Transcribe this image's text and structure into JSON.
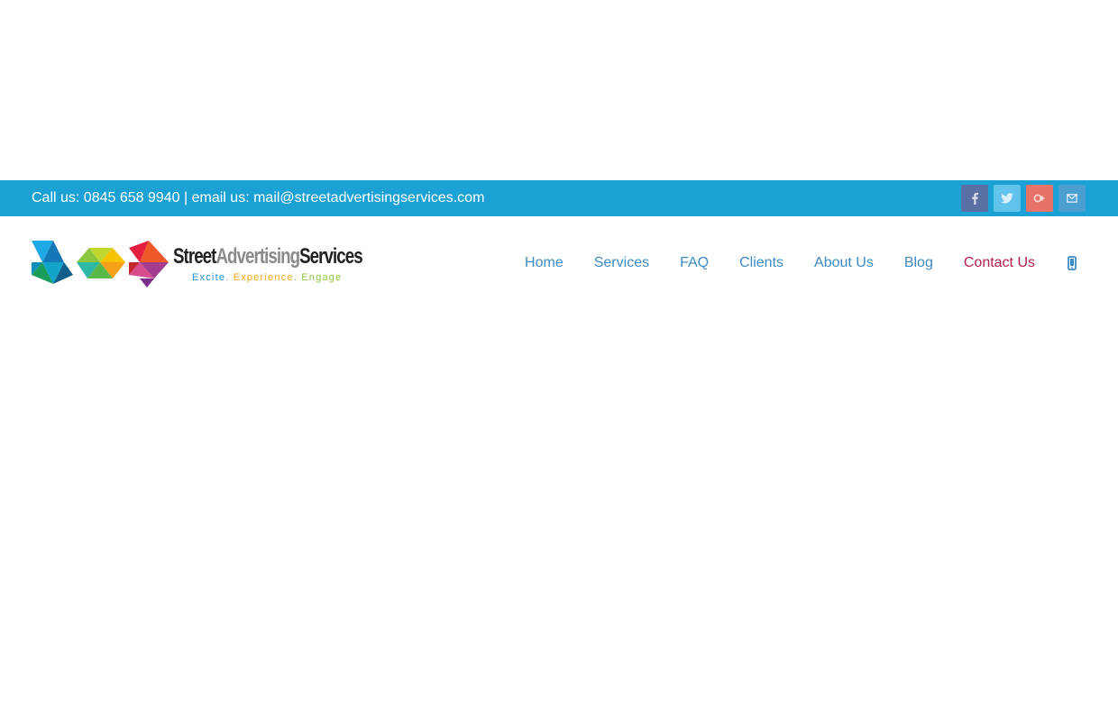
{
  "topbar": {
    "contact_text": "Call us: 0845 658 9940 | email us: mail@streetadvertisingservices.com",
    "background": "#1ba1d3",
    "social": [
      {
        "name": "facebook-icon",
        "color": "#3b5998"
      },
      {
        "name": "twitter-icon",
        "color": "#55acee"
      },
      {
        "name": "googleplus-icon",
        "color": "#dc4e41"
      },
      {
        "name": "email-icon",
        "color": "#3a8dc7"
      }
    ]
  },
  "logo": {
    "word_street": "Street",
    "word_advertising": "Advertising",
    "word_services": "Services",
    "tag_excite": "Excite",
    "tag_experience": "Experience",
    "tag_engage": "Engage",
    "tag_sep": "."
  },
  "nav": {
    "items": [
      {
        "label": "Home"
      },
      {
        "label": "Services"
      },
      {
        "label": "FAQ"
      },
      {
        "label": "Clients"
      },
      {
        "label": "About Us"
      },
      {
        "label": "Blog"
      },
      {
        "label": "Contact Us"
      }
    ],
    "active_color": "#b2214b",
    "link_color": "#3d8ac4",
    "mobile_icon": "mobile-phone-icon"
  }
}
